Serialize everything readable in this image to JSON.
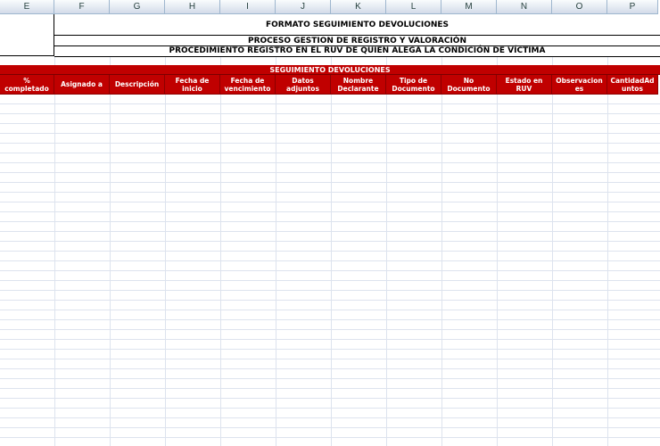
{
  "columns": [
    "E",
    "F",
    "G",
    "H",
    "I",
    "J",
    "K",
    "L",
    "M",
    "N",
    "O",
    "P"
  ],
  "title_lines": {
    "line1": "FORMATO SEGUIMIENTO DEVOLUCIONES",
    "line2": "PROCESO GESTION DE REGISTRO Y VALORACIÓN",
    "line3": "PROCEDIMIENTO REGISTRO EN EL RUV DE QUIEN ALEGA LA CONDICIÓN DE VÍCTIMA"
  },
  "section_header": "SEGUIMIENTO DEVOLUCIONES",
  "field_headers": [
    "%\ncompletado",
    "Asignado a",
    "Descripción",
    "Fecha de\ninicio",
    "Fecha de\nvencimiento",
    "Datos\nadjuntos",
    "Nombre\nDeclarante",
    "Tipo de\nDocumento",
    "No\nDocumento",
    "Estado en\nRUV",
    "Observacion\nes",
    "CantidadAd\nuntos"
  ],
  "colors": {
    "header_red": "#c00000",
    "gridline": "#dde3ee",
    "column_header_bg": "#dbe4f0"
  }
}
